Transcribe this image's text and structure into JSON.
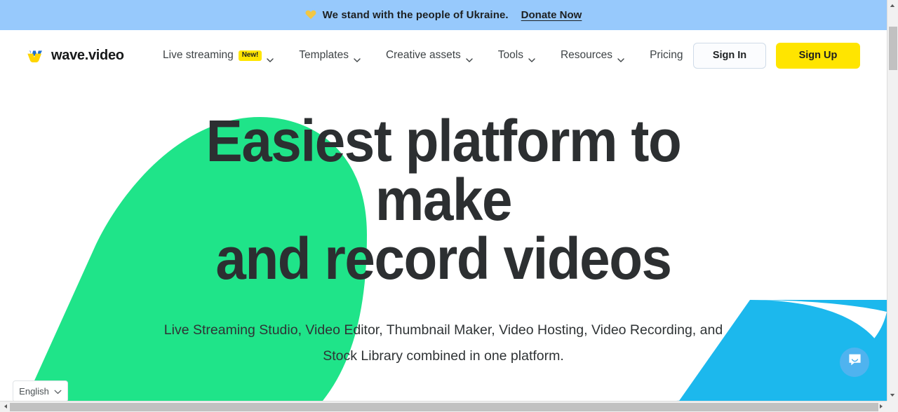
{
  "banner": {
    "icon": "yellow-heart-icon",
    "message": "We stand with the people of Ukraine.",
    "link_label": "Donate Now",
    "background_color": "#97c9fc"
  },
  "header": {
    "brand": {
      "wordmark": "wave.video",
      "mark_icon": "wave-w-logo-icon",
      "mark_top_color": "#1c6fd4",
      "mark_bottom_color": "#ffd500"
    },
    "nav_items": [
      {
        "label": "Live streaming",
        "badge": "New!",
        "has_dropdown": true
      },
      {
        "label": "Templates",
        "badge": "",
        "has_dropdown": true
      },
      {
        "label": "Creative assets",
        "badge": "",
        "has_dropdown": true
      },
      {
        "label": "Tools",
        "badge": "",
        "has_dropdown": true
      },
      {
        "label": "Resources",
        "badge": "",
        "has_dropdown": true
      },
      {
        "label": "Pricing",
        "badge": "",
        "has_dropdown": false
      }
    ],
    "sign_in_label": "Sign In",
    "sign_up_label": "Sign Up",
    "sign_up_color": "#ffe500"
  },
  "hero": {
    "headline_lines": [
      "Easiest platform to",
      "make",
      "and record videos"
    ],
    "subtitle": "Live Streaming Studio, Video Editor, Thumbnail Maker, Video Hosting, Video Recording, and Stock Library combined in one platform.",
    "shape_green_color": "#1fe489",
    "shape_blue_color": "#1cb8ed",
    "headline_color": "#2c2f31"
  },
  "language_picker": {
    "selected": "English",
    "chevron_icon": "chevron-down-icon"
  },
  "chat_widget": {
    "icon": "chat-bubble-smile-icon",
    "color": "#4fb3ef"
  },
  "scrollbars": {
    "vertical_up_icon": "scroll-up-arrow-icon",
    "vertical_down_icon": "scroll-down-arrow-icon",
    "horizontal_left_icon": "scroll-left-arrow-icon",
    "horizontal_right_icon": "scroll-right-arrow-icon"
  }
}
